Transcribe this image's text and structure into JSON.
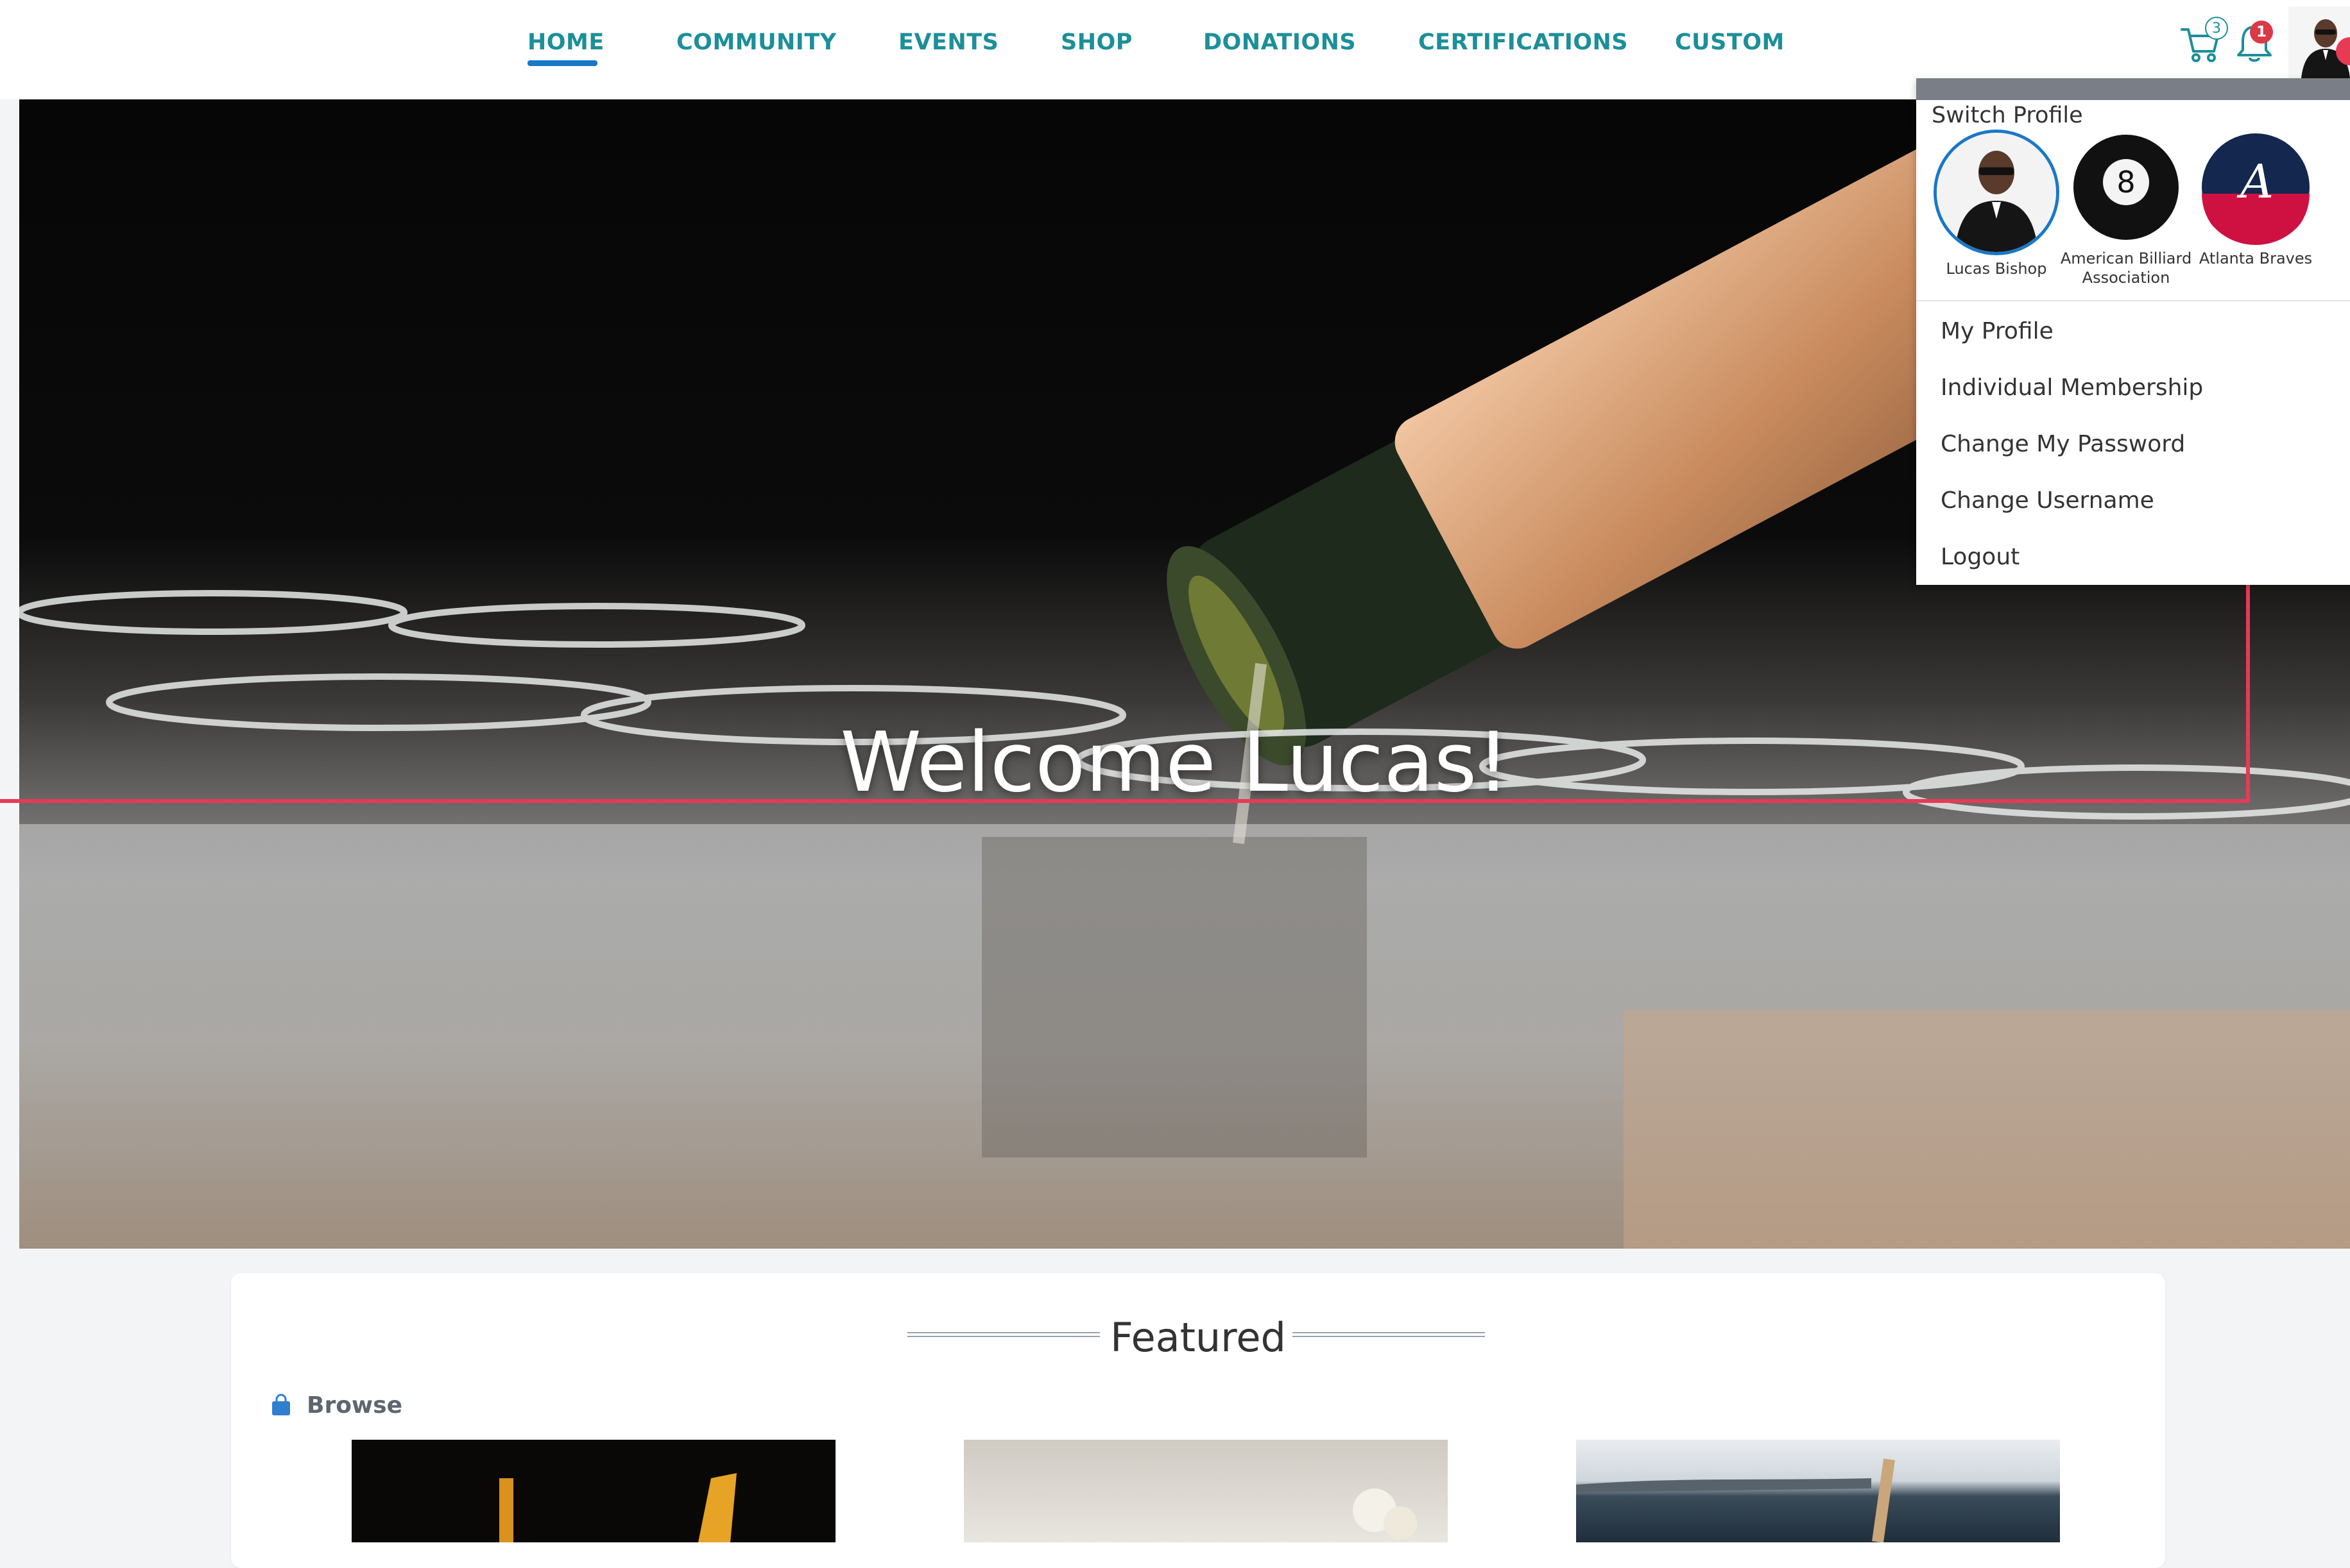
{
  "nav": {
    "items": [
      "HOME",
      "COMMUNITY",
      "EVENTS",
      "SHOP",
      "DONATIONS",
      "CERTIFICATIONS",
      "CUSTOM"
    ],
    "active": "HOME"
  },
  "header": {
    "cart_count": "3",
    "notification_count": "1",
    "cart_icon": "cart-icon",
    "bell_icon": "bell-icon"
  },
  "hero": {
    "title": "Welcome Lucas!"
  },
  "profile_menu": {
    "switch_label": "Switch Profile",
    "profiles": [
      {
        "name": "Lucas Bishop"
      },
      {
        "name_line1": "American Billiard",
        "name_line2": "Association"
      },
      {
        "name": "Atlanta Braves"
      }
    ],
    "badge_8": "8",
    "badge_a": "A",
    "items": [
      "My Profile",
      "Individual Membership",
      "Change My Password",
      "Change Username",
      "Logout"
    ]
  },
  "featured": {
    "title": "Featured",
    "browse_label": "Browse"
  },
  "colors": {
    "nav_text": "#1c8f99",
    "active_underline": "#1978c8",
    "annotation": "#e63a55",
    "bell_badge": "#d93a46"
  }
}
